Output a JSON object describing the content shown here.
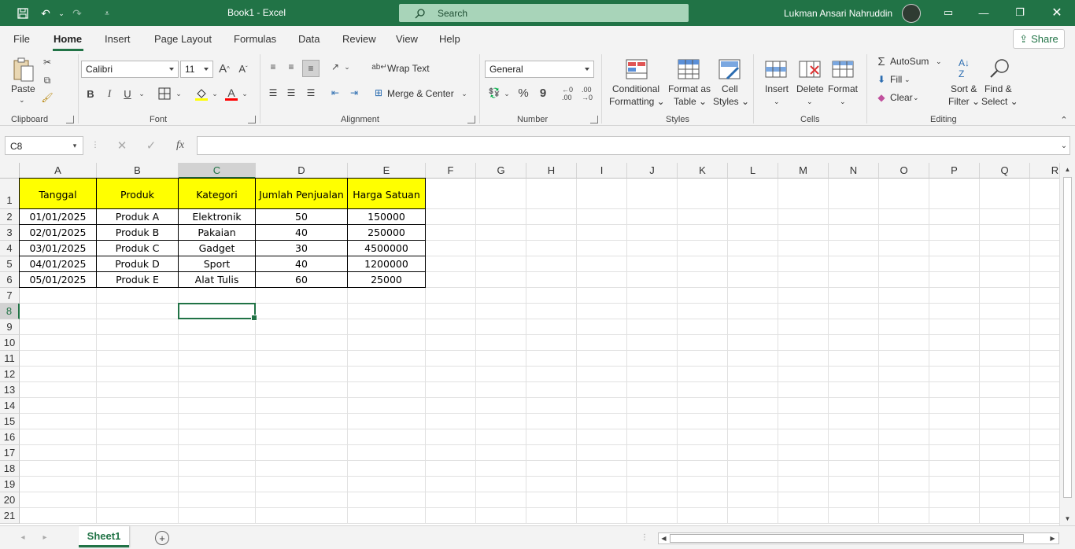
{
  "window": {
    "title": "Book1  -  Excel",
    "search_placeholder": "Search",
    "user_name": "Lukman Ansari Nahruddin"
  },
  "tabs": [
    {
      "label": "File"
    },
    {
      "label": "Home"
    },
    {
      "label": "Insert"
    },
    {
      "label": "Page Layout"
    },
    {
      "label": "Formulas"
    },
    {
      "label": "Data"
    },
    {
      "label": "Review"
    },
    {
      "label": "View"
    },
    {
      "label": "Help"
    }
  ],
  "share_label": "Share",
  "ribbon": {
    "clipboard": {
      "label": "Clipboard",
      "paste": "Paste"
    },
    "font": {
      "label": "Font",
      "name": "Calibri",
      "size": "11"
    },
    "alignment": {
      "label": "Alignment",
      "wrap_text": "Wrap Text",
      "merge_center": "Merge & Center"
    },
    "number": {
      "label": "Number",
      "format": "General"
    },
    "styles": {
      "label": "Styles",
      "conditional_1": "Conditional",
      "conditional_2": "Formatting ⌄",
      "format_table_1": "Format as",
      "format_table_2": "Table ⌄",
      "cell_styles_1": "Cell",
      "cell_styles_2": "Styles ⌄"
    },
    "cells": {
      "label": "Cells",
      "insert": "Insert",
      "delete": "Delete",
      "format": "Format"
    },
    "editing": {
      "label": "Editing",
      "autosum": "AutoSum",
      "fill": "Fill",
      "clear": "Clear",
      "sort_1": "Sort &",
      "sort_2": "Filter ⌄",
      "find_1": "Find &",
      "find_2": "Select ⌄"
    }
  },
  "formula_bar": {
    "name_box": "C8",
    "fx": "fx",
    "value": ""
  },
  "columns": [
    "A",
    "B",
    "C",
    "D",
    "E",
    "F",
    "G",
    "H",
    "I",
    "J",
    "K",
    "L",
    "M",
    "N",
    "O",
    "P",
    "Q",
    "R"
  ],
  "rows": [
    "1",
    "2",
    "3",
    "4",
    "5",
    "6",
    "7",
    "8",
    "9",
    "10",
    "11",
    "12",
    "13",
    "14",
    "15",
    "16",
    "17",
    "18",
    "19",
    "20",
    "21"
  ],
  "table": {
    "headers": [
      "Tanggal",
      "Produk",
      "Kategori",
      "Jumlah Penjualan",
      "Harga Satuan"
    ],
    "rows": [
      [
        "01/01/2025",
        "Produk A",
        "Elektronik",
        "50",
        "150000"
      ],
      [
        "02/01/2025",
        "Produk B",
        "Pakaian",
        "40",
        "250000"
      ],
      [
        "03/01/2025",
        "Produk C",
        "Gadget",
        "30",
        "4500000"
      ],
      [
        "04/01/2025",
        "Produk D",
        "Sport",
        "40",
        "1200000"
      ],
      [
        "05/01/2025",
        "Produk E",
        "Alat Tulis",
        "60",
        "25000"
      ]
    ]
  },
  "active_cell": "C8",
  "sheets": [
    {
      "label": "Sheet1"
    }
  ],
  "colors": {
    "accent": "#217346",
    "header_fill": "#ffff00"
  }
}
